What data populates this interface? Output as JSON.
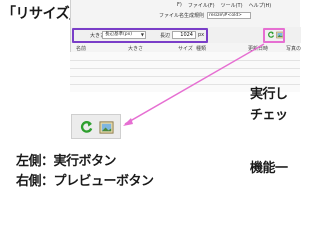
{
  "headline": "「リサイズ」のときに使用",
  "menu": [
    "F)",
    "ファイル(F)",
    "ツール(T)",
    "ヘルプ(H)"
  ],
  "filename_rule": {
    "label": "ファイル名生成規則",
    "value": "resize\\#<old>"
  },
  "toolbar": {
    "size_label": "大きさ",
    "size_mode": "長辺基準(px)",
    "edge_label": "長辺",
    "edge_value": "1024",
    "unit": "px"
  },
  "columns": [
    "名前",
    "大きさ",
    "サイズ",
    "種類",
    "更新日時",
    "写真の"
  ],
  "side_text": [
    "実行し",
    "チェッ",
    "機能一"
  ],
  "captions": {
    "left": "左側：実行ボタン",
    "right": "右側：プレビューボタン"
  },
  "icons": {
    "run": "refresh-arrow-icon",
    "preview": "image-preview-icon"
  },
  "colors": {
    "highlight_purple": "#7a3ec8",
    "highlight_pink": "#e66fd2",
    "run_icon": "#2e9f2e"
  }
}
